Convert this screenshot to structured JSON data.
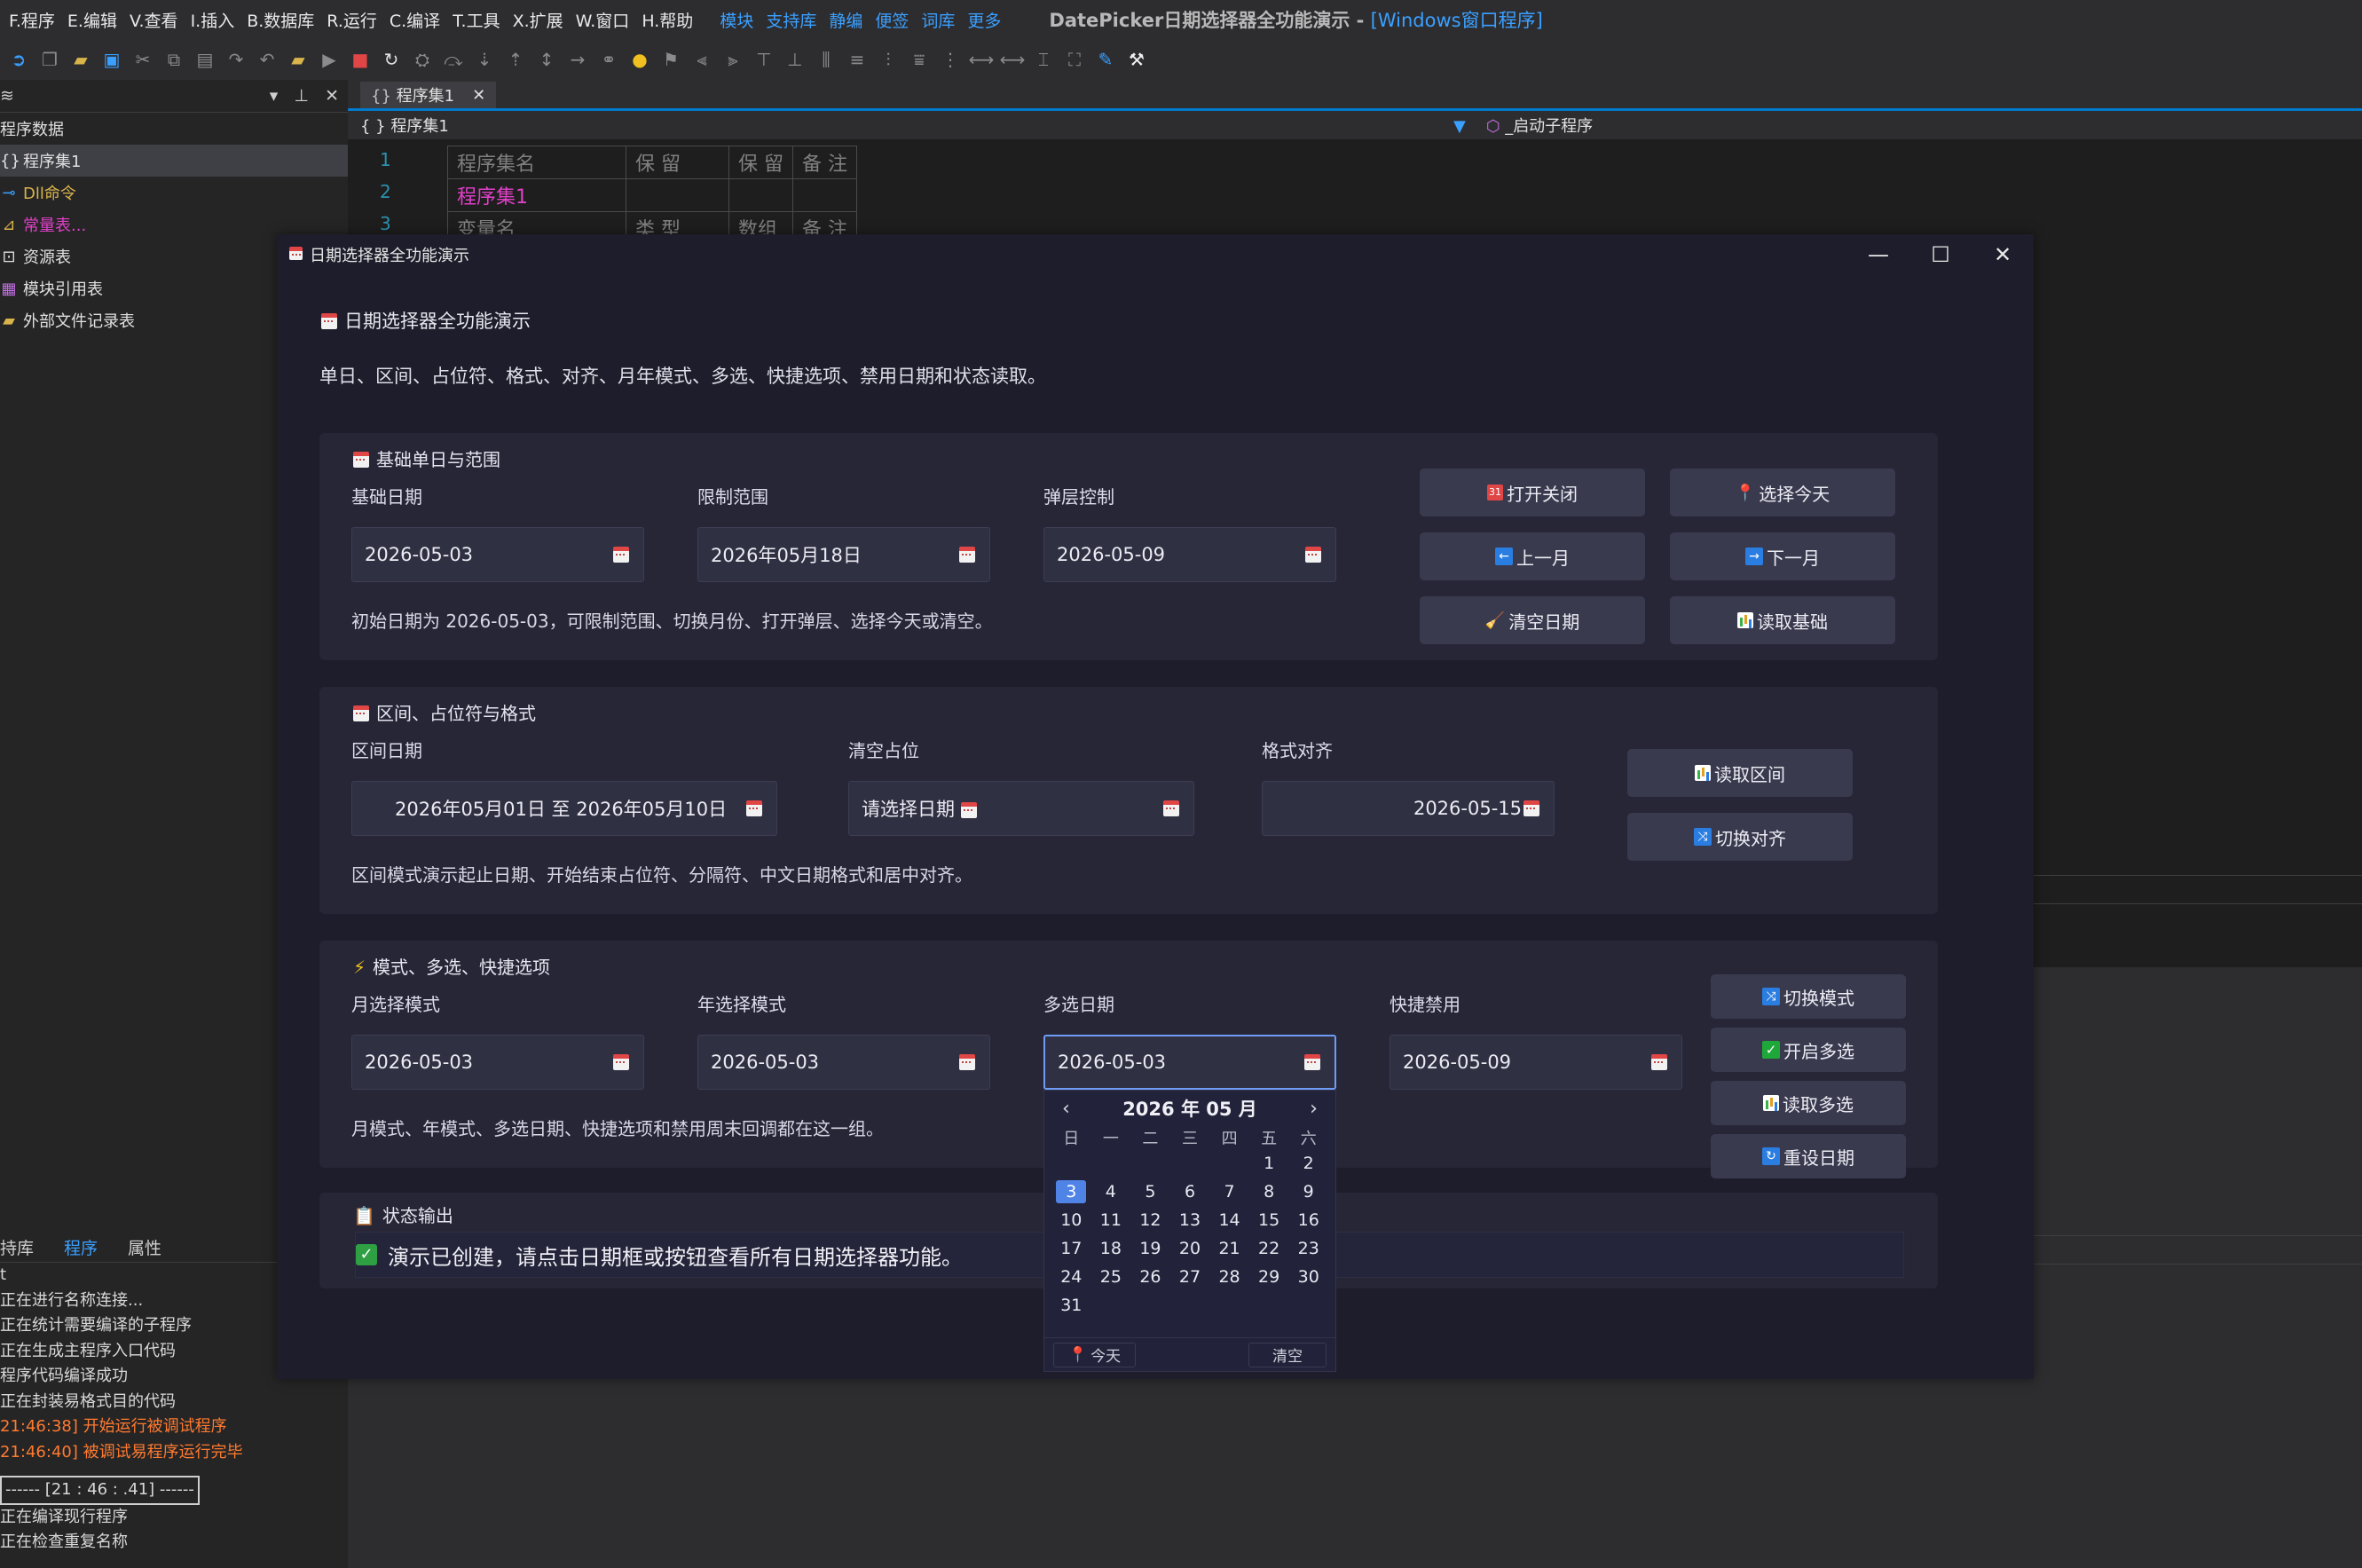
{
  "ide": {
    "menu": [
      "F.程序",
      "E.编辑",
      "V.查看",
      "I.插入",
      "B.数据库",
      "R.运行",
      "C.编译",
      "T.工具",
      "X.扩展",
      "W.窗口",
      "H.帮助"
    ],
    "menu_links": [
      "模块",
      "支持库",
      "静编",
      "便签",
      "词库",
      "更多"
    ],
    "window_title": "DatePicker日期选择器全功能演示 - ",
    "window_title_tag": "[Windows窗口程序]",
    "left_panel": {
      "header": "程序数据",
      "items": [
        "程序集1",
        "Dll命令",
        "常量表...",
        "资源表",
        "模块引用表",
        "外部文件记录表"
      ]
    },
    "bottom_tabs": [
      "持库",
      "程序",
      "属性"
    ],
    "log": [
      "t",
      "正在进行名称连接...",
      "正在统计需要编译的子程序",
      "正在生成主程序入口代码",
      "程序代码编译成功",
      "正在封装易格式目的代码"
    ],
    "log_orange": [
      "21:46:38] 开始运行被调试程序",
      "21:46:40] 被调试易程序运行完毕"
    ],
    "log_box": "------ [21 : 46 : .41] ------",
    "log_tail": [
      "正在编译现行程序",
      "正在检查重复名称"
    ],
    "editor_tab": "程序集1",
    "editor_crumb": "{ } 程序集1",
    "editor_right": "_启动子程序",
    "line_numbers": [
      "1",
      "2",
      "3"
    ],
    "code_table": {
      "header": [
        "程序集名",
        "保 留",
        "保 留",
        "备 注"
      ],
      "row": [
        "程序集1",
        "",
        "",
        ""
      ],
      "row3": [
        "变量名",
        "类 型",
        "数组",
        "备 注"
      ]
    }
  },
  "dialog": {
    "title": "日期选择器全功能演示",
    "heading": "日期选择器全功能演示",
    "subtitle": "单日、区间、占位符、格式、对齐、月年模式、多选、快捷选项、禁用日期和状态读取。",
    "section1": {
      "title": "基础单日与范围",
      "labels": [
        "基础日期",
        "限制范围",
        "弹层控制"
      ],
      "values": [
        "2026-05-03",
        "2026年05月18日",
        "2026-05-09"
      ],
      "note": "初始日期为 2026-05-03，可限制范围、切换月份、打开弹层、选择今天或清空。",
      "buttons": [
        "打开关闭",
        "选择今天",
        "上一月",
        "下一月",
        "清空日期",
        "读取基础"
      ]
    },
    "section2": {
      "title": "区间、占位符与格式",
      "labels": [
        "区间日期",
        "清空占位",
        "格式对齐"
      ],
      "values": [
        "2026年05月01日 至 2026年05月10日",
        "请选择日期",
        "2026-05-15"
      ],
      "note": "区间模式演示起止日期、开始结束占位符、分隔符、中文日期格式和居中对齐。",
      "buttons": [
        "读取区间",
        "切换对齐"
      ]
    },
    "section3": {
      "title": "模式、多选、快捷选项",
      "labels": [
        "月选择模式",
        "年选择模式",
        "多选日期",
        "快捷禁用"
      ],
      "values": [
        "2026-05-03",
        "2026-05-03",
        "2026-05-03",
        "2026-05-09"
      ],
      "note": "月模式、年模式、多选日期、快捷选项和禁用周末回调都在这一组。",
      "buttons": [
        "切换模式",
        "开启多选",
        "读取多选",
        "重设日期"
      ]
    },
    "status": {
      "title": "状态输出",
      "text": "演示已创建，请点击日期框或按钮查看所有日期选择器功能。"
    },
    "calendar": {
      "header": "2026 年 05 月",
      "weekdays": [
        "日",
        "一",
        "二",
        "三",
        "四",
        "五",
        "六"
      ],
      "days": [
        "",
        "",
        "",
        "",
        "",
        "1",
        "2",
        "3",
        "4",
        "5",
        "6",
        "7",
        "8",
        "9",
        "10",
        "11",
        "12",
        "13",
        "14",
        "15",
        "16",
        "17",
        "18",
        "19",
        "20",
        "21",
        "22",
        "23",
        "24",
        "25",
        "26",
        "27",
        "28",
        "29",
        "30",
        "31"
      ],
      "selected": "3",
      "today_label": "今天",
      "clear_label": "清空"
    }
  },
  "colors": {
    "accent": "#4f83e6",
    "ide_blue": "#3aa0ff",
    "orange": "#ff7a2f",
    "dialog_bg": "#1d1d2b",
    "card_bg": "#262637"
  }
}
